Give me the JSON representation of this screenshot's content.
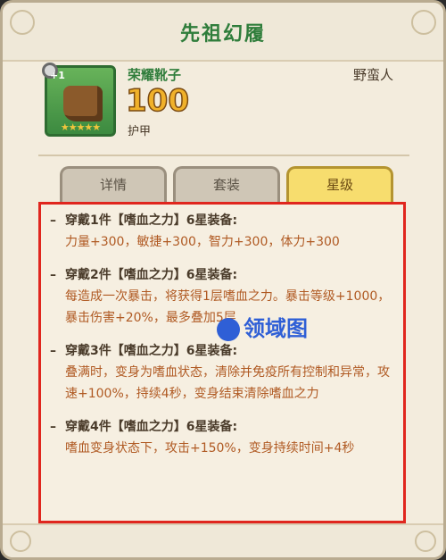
{
  "window": {
    "title": "先祖幻履"
  },
  "item": {
    "level_badge": "+1",
    "name": "荣耀靴子",
    "class": "野蛮人",
    "value": "100",
    "stat_label": "护甲",
    "stars": "★★★★★",
    "icon": "boots-icon"
  },
  "tabs": [
    {
      "label": "详情"
    },
    {
      "label": "套装"
    },
    {
      "label": "星级",
      "active": true
    }
  ],
  "set_bonuses": [
    {
      "header": "穿戴1件【嗜血之力】6星装备:",
      "desc": "力量+300，敏捷+300，智力+300，体力+300"
    },
    {
      "header": "穿戴2件【嗜血之力】6星装备:",
      "desc": "每造成一次暴击，将获得1层嗜血之力。暴击等级+1000，暴击伤害+20%，最多叠加5层"
    },
    {
      "header": "穿戴3件【嗜血之力】6星装备:",
      "desc": "叠满时，变身为嗜血状态，清除并免疫所有控制和异常，攻速+100%，持续4秒，变身结束清除嗜血之力"
    },
    {
      "header": "穿戴4件【嗜血之力】6星装备:",
      "desc": "嗜血变身状态下，攻击+150%，变身持续时间+4秒"
    }
  ],
  "watermark": {
    "text": "领域图"
  },
  "colors": {
    "title_green": "#2f7d3b",
    "highlight_red": "#e0261e",
    "desc_orange": "#b05a23",
    "tab_active": "#f7dd6e"
  }
}
